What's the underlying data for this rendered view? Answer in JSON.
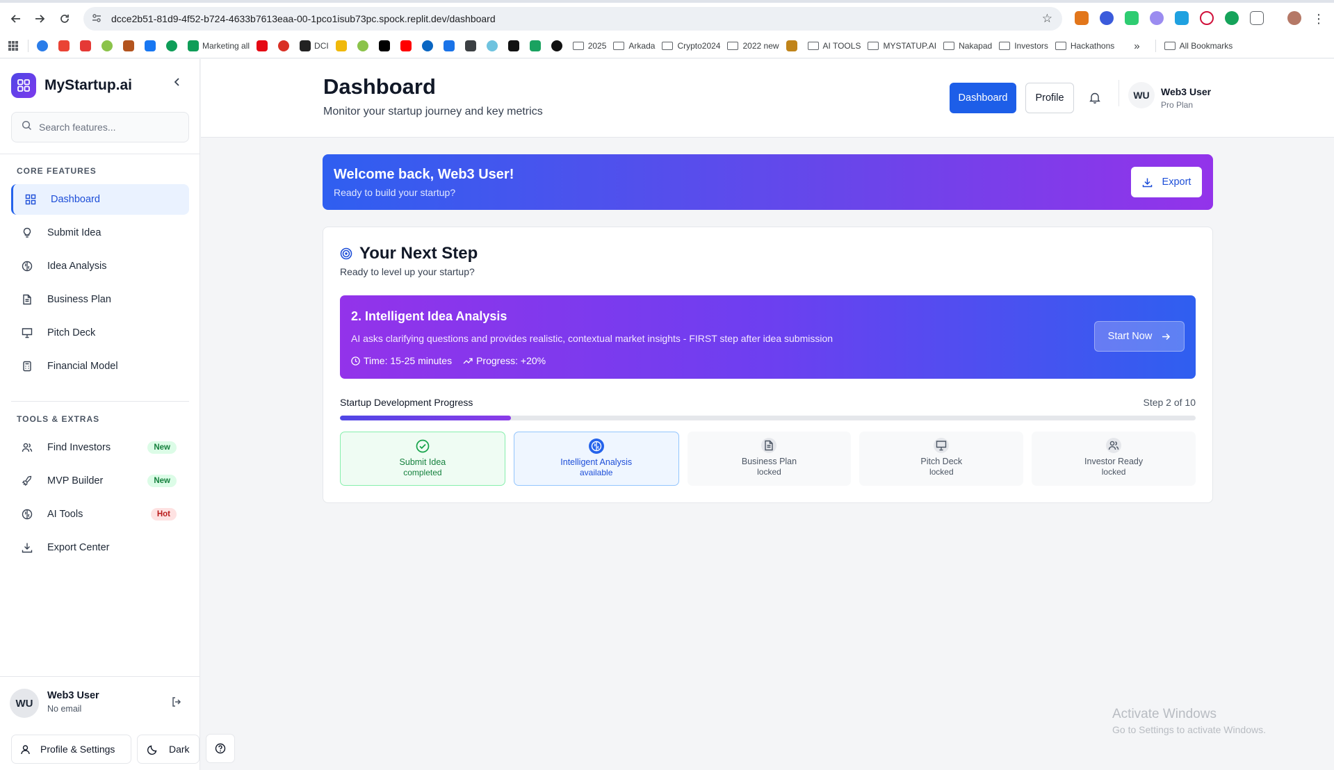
{
  "browser": {
    "url": "dcce2b51-81d9-4f52-b724-4633b7613eaa-00-1pco1isub73pc.spock.replit.dev/dashboard",
    "bookmarks": [
      {
        "label": "",
        "icon": "edge-icon",
        "color": "#2b7de9"
      },
      {
        "label": "",
        "icon": "google-icon",
        "color": "#ea4335"
      },
      {
        "label": "",
        "icon": "d-app-icon",
        "color": "#e53935"
      },
      {
        "label": "",
        "icon": "leaf-icon",
        "color": "#8bc34a"
      },
      {
        "label": "",
        "icon": "chrome-app-icon",
        "color": "#b3541e"
      },
      {
        "label": "",
        "icon": "facebook-icon",
        "color": "#1877f2"
      },
      {
        "label": "",
        "icon": "sheets-icon",
        "color": "#0f9d58"
      },
      {
        "label": "Marketing all",
        "icon": "sheets-icon",
        "color": "#0f9d58"
      },
      {
        "label": "",
        "icon": "netflix-icon",
        "color": "#e50914"
      },
      {
        "label": "",
        "icon": "gmail-icon",
        "color": "#d93025"
      },
      {
        "label": "DCI",
        "icon": "dci-icon",
        "color": "#222222"
      },
      {
        "label": "",
        "icon": "binance-icon",
        "color": "#f0b90b"
      },
      {
        "label": "",
        "icon": "leaf-icon",
        "color": "#8bc34a"
      },
      {
        "label": "",
        "icon": "x-icon",
        "color": "#000000"
      },
      {
        "label": "",
        "icon": "youtube-icon",
        "color": "#ff0000"
      },
      {
        "label": "",
        "icon": "linkedin-icon",
        "color": "#0a66c2"
      },
      {
        "label": "",
        "icon": "app-icon",
        "color": "#1a73e8"
      },
      {
        "label": "",
        "icon": "globe-icon",
        "color": "#3c4043"
      },
      {
        "label": "",
        "icon": "wave-icon",
        "color": "#6fc3df"
      },
      {
        "label": "",
        "icon": "pocket-icon",
        "color": "#111111"
      },
      {
        "label": "",
        "icon": "ship-icon",
        "color": "#1aa260"
      },
      {
        "label": "",
        "icon": "zap-icon",
        "color": "#111111"
      },
      {
        "label": "2025",
        "icon": "folder-icon",
        "color": "#5f6368"
      },
      {
        "label": "Arkada",
        "icon": "folder-icon",
        "color": "#5f6368"
      },
      {
        "label": "Crypto2024",
        "icon": "folder-icon",
        "color": "#5f6368"
      },
      {
        "label": "2022 new",
        "icon": "folder-icon",
        "color": "#5f6368"
      },
      {
        "label": "",
        "icon": "tool-icon",
        "color": "#c0841a"
      },
      {
        "label": "AI TOOLS",
        "icon": "folder-icon",
        "color": "#5f6368"
      },
      {
        "label": "MYSTATUP.AI",
        "icon": "folder-icon",
        "color": "#5f6368"
      },
      {
        "label": "Nakapad",
        "icon": "folder-icon",
        "color": "#5f6368"
      },
      {
        "label": "Investors",
        "icon": "folder-icon",
        "color": "#5f6368"
      },
      {
        "label": "Hackathons",
        "icon": "folder-icon",
        "color": "#5f6368"
      }
    ],
    "more_label": "»",
    "all_bookmarks": "All Bookmarks"
  },
  "sidebar": {
    "brand": "MyStartup.ai",
    "search_placeholder": "Search features...",
    "core_title": "CORE FEATURES",
    "core_items": [
      {
        "label": "Dashboard",
        "icon": "grid-icon",
        "active": true
      },
      {
        "label": "Submit Idea",
        "icon": "lightbulb-icon"
      },
      {
        "label": "Idea Analysis",
        "icon": "brain-icon"
      },
      {
        "label": "Business Plan",
        "icon": "document-icon"
      },
      {
        "label": "Pitch Deck",
        "icon": "presentation-icon"
      },
      {
        "label": "Financial Model",
        "icon": "calculator-icon"
      }
    ],
    "tools_title": "TOOLS & EXTRAS",
    "tools_items": [
      {
        "label": "Find Investors",
        "icon": "users-icon",
        "badge": "New"
      },
      {
        "label": "MVP Builder",
        "icon": "rocket-icon",
        "badge": "New"
      },
      {
        "label": "AI Tools",
        "icon": "brain-icon",
        "badge": "Hot"
      },
      {
        "label": "Export Center",
        "icon": "download-icon"
      }
    ],
    "user": {
      "initials": "WU",
      "name": "Web3 User",
      "email": "No email"
    },
    "profile_settings": "Profile & Settings",
    "dark_label": "Dark"
  },
  "header": {
    "title": "Dashboard",
    "subtitle": "Monitor your startup journey and key metrics",
    "dashboard_btn": "Dashboard",
    "profile_btn": "Profile",
    "user_initials": "WU",
    "user_name": "Web3 User",
    "user_plan": "Pro Plan"
  },
  "welcome": {
    "title": "Welcome back, Web3 User!",
    "subtitle": "Ready to build your startup?",
    "export_label": "Export"
  },
  "next_step": {
    "title": "Your Next Step",
    "subtitle": "Ready to level up your startup?",
    "step_title": "2. Intelligent Idea Analysis",
    "step_desc": "AI asks clarifying questions and provides realistic, contextual market insights - FIRST step after idea submission",
    "time": "Time: 15-25 minutes",
    "progress": "Progress: +20%",
    "start_label": "Start Now"
  },
  "progress": {
    "label": "Startup Development Progress",
    "step_text": "Step 2 of 10",
    "fraction": 0.2,
    "steps": [
      {
        "name": "Submit Idea",
        "status": "completed",
        "icon": "check-circle-icon"
      },
      {
        "name": "Intelligent Analysis",
        "status": "available",
        "icon": "brain-icon"
      },
      {
        "name": "Business Plan",
        "status": "locked",
        "icon": "document-icon"
      },
      {
        "name": "Pitch Deck",
        "status": "locked",
        "icon": "presentation-icon"
      },
      {
        "name": "Investor Ready",
        "status": "locked",
        "icon": "users-icon"
      }
    ]
  },
  "watermark": {
    "line1": "Activate Windows",
    "line2": "Go to Settings to activate Windows."
  },
  "colors": {
    "primary": "#1d5ee8",
    "accent_purple": "#9333ea",
    "new_badge": "#15803d",
    "hot_badge": "#b91c1c"
  }
}
